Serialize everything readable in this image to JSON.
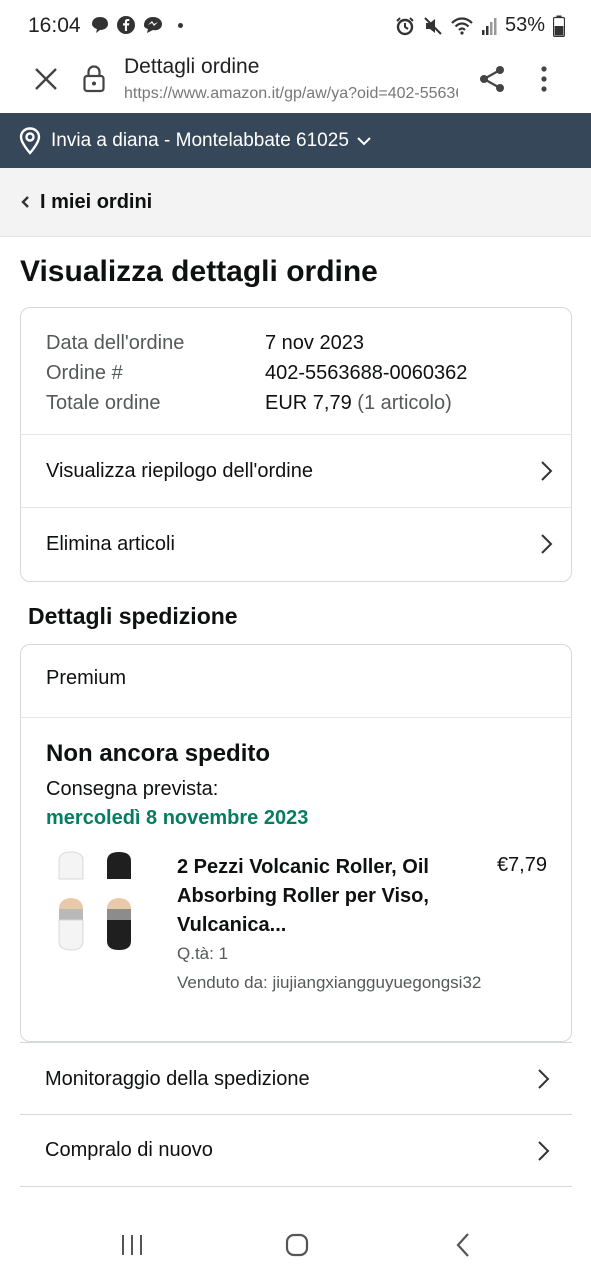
{
  "status_bar": {
    "time": "16:04",
    "battery": "53%",
    "left_icons": [
      "chat-bubble-icon",
      "facebook-icon",
      "messenger-icon"
    ],
    "right_icons": [
      "alarm-icon",
      "mute-icon",
      "wifi-icon",
      "signal-icon",
      "battery-icon"
    ]
  },
  "browser": {
    "title": "Dettagli ordine",
    "url": "https://www.amazon.it/gp/aw/ya?oid=402-5563688-0060362"
  },
  "delivery_bar": {
    "text": "Invia a diana - Montelabbate 61025"
  },
  "nav": {
    "back_label": "I miei ordini"
  },
  "page_title": "Visualizza dettagli ordine",
  "order_summary": {
    "date_label": "Data dell'ordine",
    "date_value": "7 nov 2023",
    "number_label": "Ordine #",
    "number_value": "402-5563688-0060362",
    "total_label": "Totale ordine",
    "total_value": "EUR 7,79",
    "total_items": "(1 articolo)",
    "actions": [
      "Visualizza riepilogo dell'ordine",
      "Elimina articoli"
    ]
  },
  "shipping": {
    "section_title": "Dettagli spedizione",
    "service": "Premium",
    "status": "Non ancora spedito",
    "delivery_label": "Consegna prevista:",
    "delivery_date": "mercoledì 8 novembre 2023",
    "product": {
      "name": "2 Pezzi Volcanic Roller, Oil Absorbing Roller per Viso, Vulcanica...",
      "price": "€7,79",
      "qty": "Q.tà: 1",
      "seller": "Venduto da: jiujiangxiangguyuegongsi32"
    }
  },
  "order_actions": [
    "Monitoraggio della spedizione",
    "Compralo di nuovo"
  ],
  "colors": {
    "delivery_bar": "#37475a",
    "delivery_date": "#067d62",
    "card_border": "#d5d9d9"
  }
}
